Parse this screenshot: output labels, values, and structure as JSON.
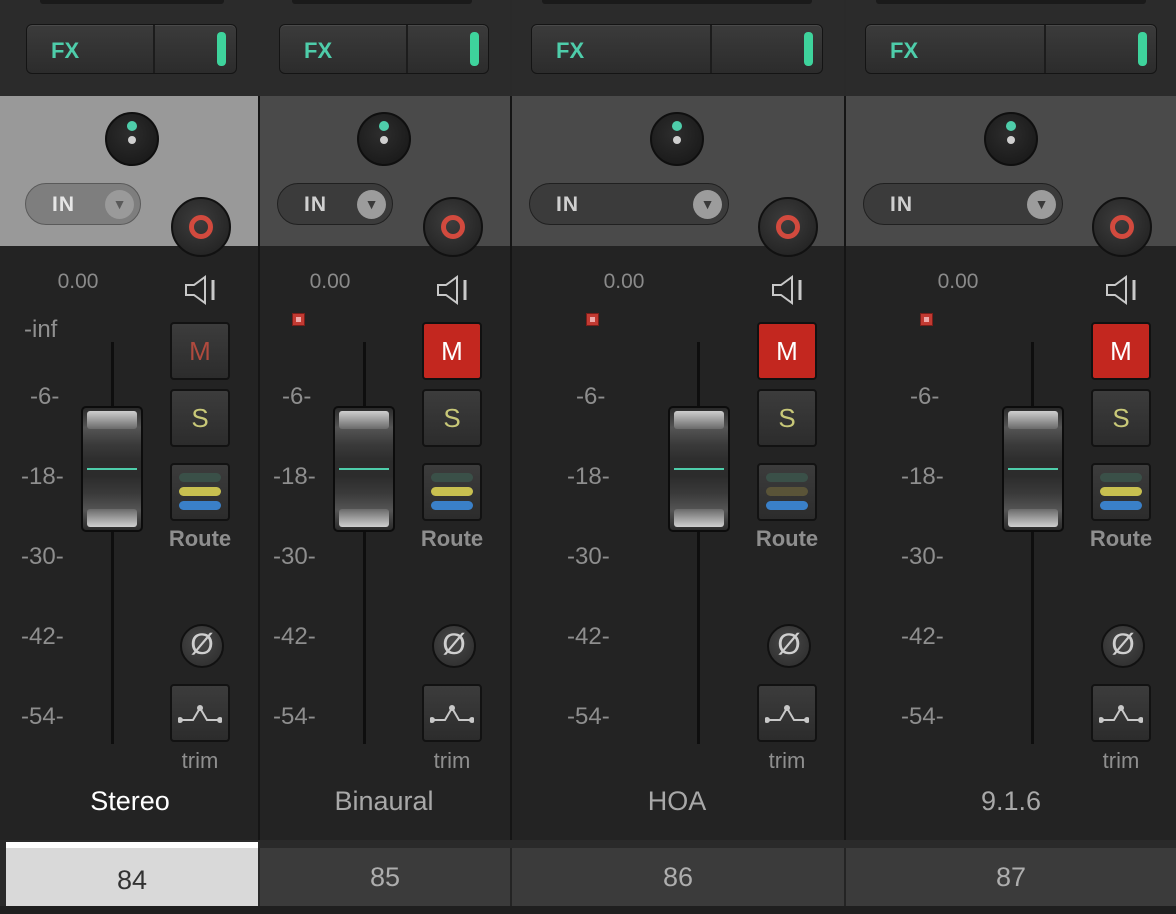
{
  "fx_label": "FX",
  "input_label": "IN",
  "route_label": "Route",
  "trim_label": "trim",
  "mute_label": "M",
  "solo_label": "S",
  "phase_symbol": "Ø",
  "colors": {
    "fx_accent": "#4ecdaa",
    "record": "#d24a3e",
    "mute_active": "#c3271f",
    "selected_header": "#999999",
    "unselected_header": "#4a4a4a"
  },
  "scale_labels": [
    "-6-",
    "-18-",
    "-30-",
    "-42-",
    "-54-"
  ],
  "tracks": [
    {
      "name": "Stereo",
      "number": "84",
      "volume": "0.00",
      "peak": "-inf",
      "selected": true,
      "muted": false,
      "clip": false,
      "route_colors": [
        "#3a5048",
        "#c8c050",
        "#3a80c8"
      ]
    },
    {
      "name": "Binaural",
      "number": "85",
      "volume": "0.00",
      "peak": "",
      "selected": false,
      "muted": true,
      "clip": true,
      "route_colors": [
        "#3a5048",
        "#c8c050",
        "#3a80c8"
      ]
    },
    {
      "name": "HOA",
      "number": "86",
      "volume": "0.00",
      "peak": "",
      "selected": false,
      "muted": true,
      "clip": true,
      "route_colors": [
        "#3a5048",
        "#5a5438",
        "#3a80c8"
      ]
    },
    {
      "name": "9.1.6",
      "number": "87",
      "volume": "0.00",
      "peak": "",
      "selected": false,
      "muted": true,
      "clip": true,
      "route_colors": [
        "#3a5048",
        "#c8c050",
        "#3a80c8"
      ]
    }
  ]
}
